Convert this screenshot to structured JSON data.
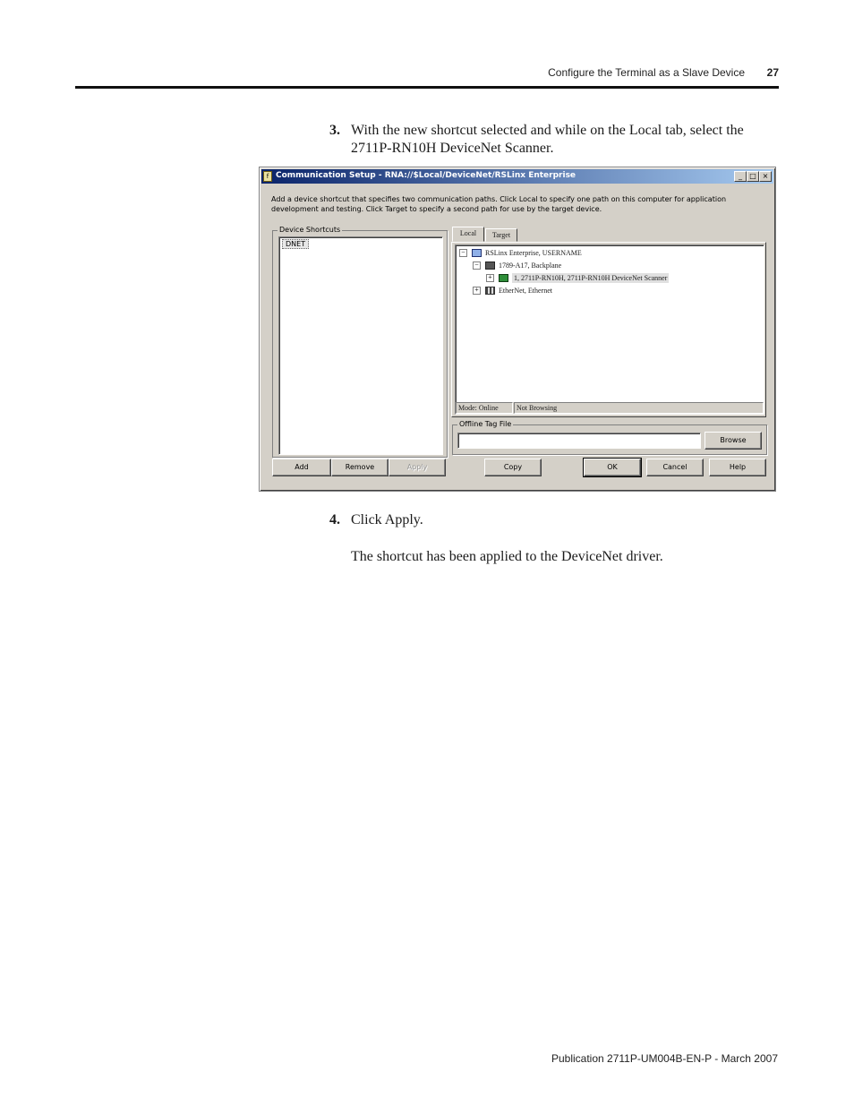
{
  "header": {
    "section_title": "Configure the Terminal as a Slave Device",
    "page_number": "27"
  },
  "steps": [
    {
      "number": "3.",
      "text": "With the new shortcut selected and while on the Local tab, select the 2711P-RN10H DeviceNet Scanner."
    },
    {
      "number": "4.",
      "text": "Click Apply."
    }
  ],
  "result_text": "The shortcut has been applied to the DeviceNet driver.",
  "footer": {
    "publication": "Publication 2711P-UM004B-EN-P - March 2007"
  },
  "dialog": {
    "title": "Communication Setup - RNA://$Local/DeviceNet/RSLinx Enterprise",
    "window_buttons": {
      "minimize": "_",
      "maximize": "□",
      "close": "×"
    },
    "intro": "Add a device shortcut that specifies two communication paths. Click Local to specify one path on this computer for application development and testing. Click Target to specify a second path for use by the target device.",
    "device_shortcuts": {
      "label": "Device Shortcuts",
      "items": [
        "DNET"
      ]
    },
    "tabs": [
      {
        "label": "Local",
        "active": true
      },
      {
        "label": "Target",
        "active": false
      }
    ],
    "tree": [
      {
        "label": "RSLinx Enterprise, USERNAME",
        "icon": "computer-icon",
        "expander": "−"
      },
      {
        "label": "1789-A17, Backplane",
        "icon": "backplane-icon",
        "expander": "−"
      },
      {
        "label": "1, 2711P-RN10H, 2711P-RN10H DeviceNet Scanner",
        "icon": "scanner-card-icon",
        "expander": "+",
        "selected": true
      },
      {
        "label": "EtherNet, Ethernet",
        "icon": "network-icon",
        "expander": "+"
      }
    ],
    "status": {
      "mode": "Mode: Online",
      "browsing": "Not Browsing"
    },
    "offline_tag_file": {
      "label": "Offline Tag File",
      "value": "",
      "browse_label": "Browse"
    },
    "buttons": {
      "add": "Add",
      "remove": "Remove",
      "apply": "Apply",
      "copy": "Copy",
      "ok": "OK",
      "cancel": "Cancel",
      "help": "Help"
    },
    "colors": {
      "title_gradient_start": "#0a246a",
      "title_gradient_end": "#a6caf0",
      "face": "#d4d0c8"
    }
  }
}
